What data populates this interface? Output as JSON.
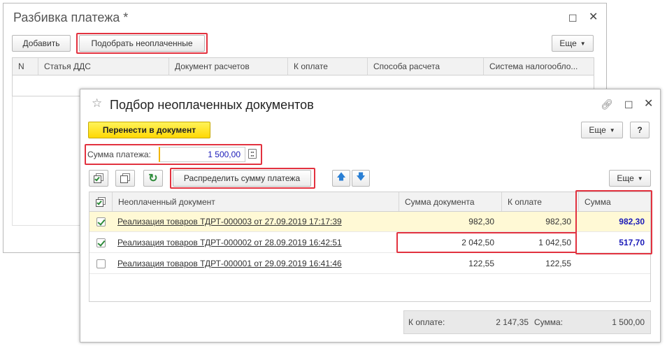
{
  "back_window": {
    "title": "Разбивка платежа *",
    "add_label": "Добавить",
    "pick_unpaid_label": "Подобрать неоплаченные",
    "more_label": "Еще",
    "columns": [
      "N",
      "Статья ДДС",
      "Документ расчетов",
      "К оплате",
      "Способа расчета",
      "Система налогообло..."
    ]
  },
  "front_window": {
    "title": "Подбор неоплаченных документов",
    "transfer_label": "Перенести в документ",
    "more_label": "Еще",
    "help_label": "?",
    "payment_sum_label": "Сумма платежа:",
    "payment_sum_value": "1 500,00",
    "distribute_label": "Распределить сумму платежа",
    "more2_label": "Еще",
    "columns": {
      "doc": "Неоплаченный документ",
      "doc_sum": "Сумма документа",
      "to_pay": "К оплате",
      "sum": "Сумма"
    },
    "rows": [
      {
        "checked": true,
        "doc": "Реализация товаров ТДРТ-000003 от 27.09.2019 17:17:39",
        "doc_sum": "982,30",
        "to_pay": "982,30",
        "sum": "982,30"
      },
      {
        "checked": true,
        "doc": "Реализация товаров ТДРТ-000002 от 28.09.2019 16:42:51",
        "doc_sum": "2 042,50",
        "to_pay": "1 042,50",
        "sum": "517,70"
      },
      {
        "checked": false,
        "doc": "Реализация товаров ТДРТ-000001 от 29.09.2019 16:41:46",
        "doc_sum": "122,55",
        "to_pay": "122,55",
        "sum": ""
      }
    ],
    "footer": {
      "to_pay_label": "К оплате:",
      "to_pay_value": "2 147,35",
      "sum_label": "Сумма:",
      "sum_value": "1 500,00"
    }
  },
  "colors": {
    "highlight": "#e2323f",
    "accent_blue": "#1a1ab8",
    "yellow_button": "#ffd803",
    "selected_row": "#fff9d5"
  }
}
